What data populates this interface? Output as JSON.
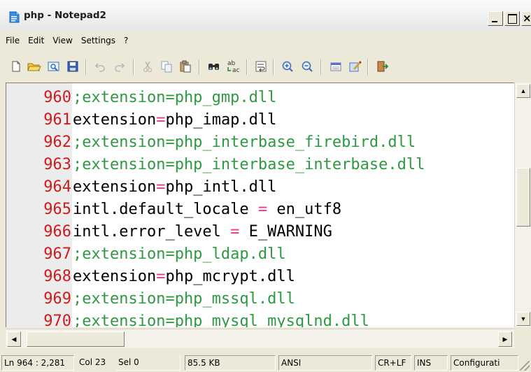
{
  "window": {
    "title": "php - Notepad2"
  },
  "menu": [
    "File",
    "Edit",
    "View",
    "Settings",
    "?"
  ],
  "toolbar": {
    "buttons": [
      "new-file-icon",
      "open-folder-icon",
      "browse-icon",
      "save-icon",
      "undo-icon",
      "redo-icon",
      "cut-icon",
      "copy-icon",
      "paste-icon",
      "find-icon",
      "replace-icon",
      "word-wrap-icon",
      "zoom-in-icon",
      "zoom-out-icon",
      "view-icon",
      "scheme-icon",
      "exit-icon"
    ]
  },
  "editor": {
    "lines": [
      {
        "num": "960",
        "text": ";extension=php_gmp.dll",
        "type": "comment"
      },
      {
        "num": "961",
        "text": "extension=php_imap.dll",
        "type": "plain"
      },
      {
        "num": "962",
        "text": ";extension=php_interbase_firebird.dll",
        "type": "comment"
      },
      {
        "num": "963",
        "text": ";extension=php_interbase_interbase.dll",
        "type": "comment"
      },
      {
        "num": "964",
        "text": "extension=php_intl.dll",
        "type": "plain"
      },
      {
        "num": "965",
        "key": "intl.default_locale",
        "eq": " = ",
        "value": "en_utf8",
        "type": "kv"
      },
      {
        "num": "966",
        "key": "intl.error_level",
        "eq": " = ",
        "value": "E_WARNING",
        "type": "kv"
      },
      {
        "num": "967",
        "text": ";extension=php_ldap.dll",
        "type": "comment"
      },
      {
        "num": "968",
        "text": "extension=php_mcrypt.dll",
        "type": "plain"
      },
      {
        "num": "969",
        "text": ";extension=php_mssql.dll",
        "type": "comment"
      },
      {
        "num": "970",
        "text": ";extension=php_mysql_mysqlnd.dll",
        "type": "comment"
      }
    ]
  },
  "status": {
    "position": "Ln 964 : 2,281",
    "column": "Col 23",
    "selection": "Sel 0",
    "size": "85.5 KB",
    "encoding": "ANSI",
    "line_endings": "CR+LF",
    "mode": "INS",
    "scheme": "Configurati"
  },
  "colors": {
    "line_number": "#cc1c1c",
    "comment": "#2d9a42",
    "operator": "#e8398c"
  }
}
